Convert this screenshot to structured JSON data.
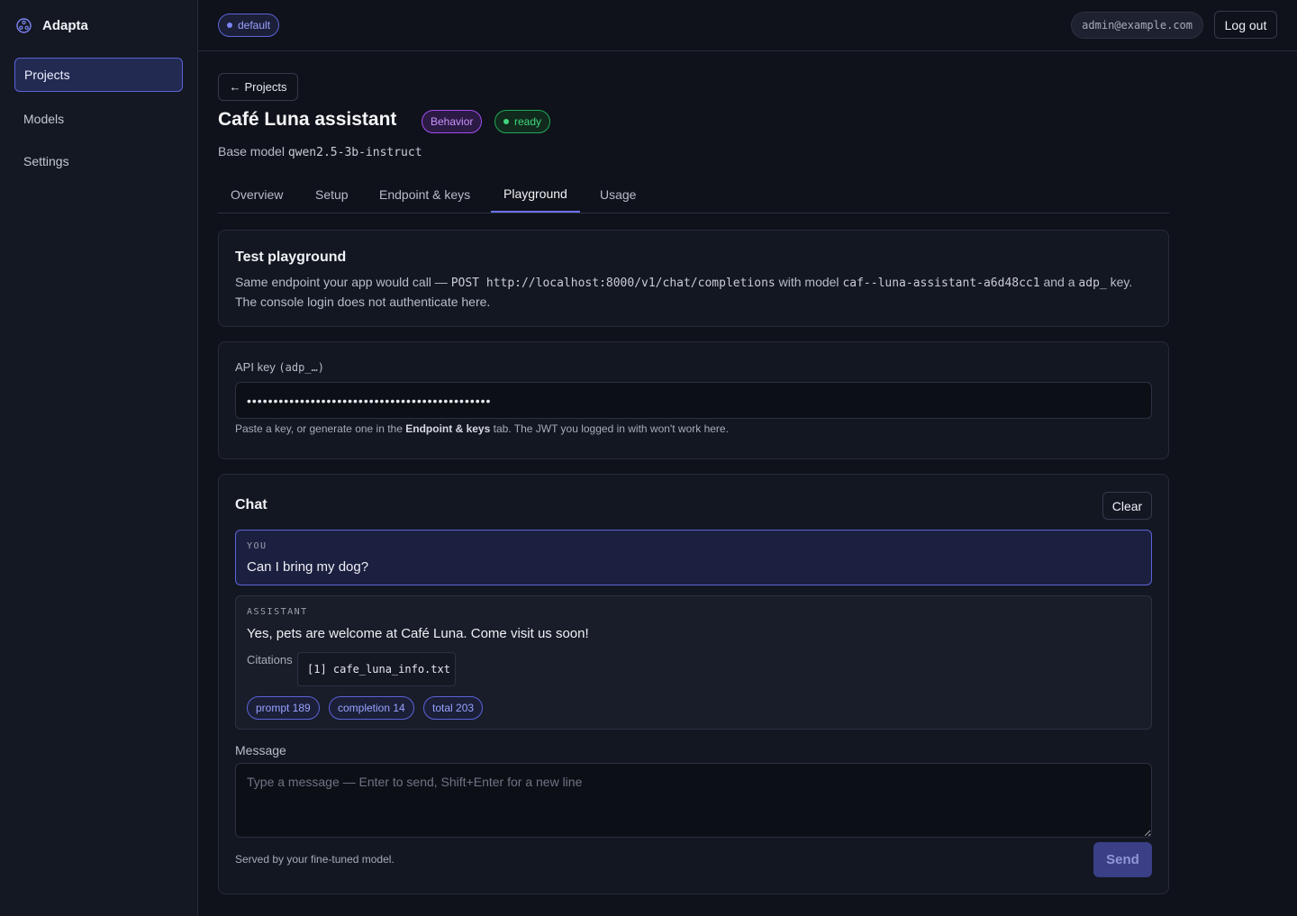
{
  "app": {
    "name": "Adapta"
  },
  "sidebar": {
    "items": [
      {
        "label": "Projects",
        "active": true
      },
      {
        "label": "Models",
        "active": false
      },
      {
        "label": "Settings",
        "active": false
      }
    ]
  },
  "topbar": {
    "namespace": "default",
    "user_email": "admin@example.com",
    "logout_label": "Log out"
  },
  "project": {
    "back_label": "Projects",
    "title": "Café Luna assistant",
    "type_badge": "Behavior",
    "status_badge": "ready",
    "base_model_label": "Base model",
    "base_model": "qwen2.5-3b-instruct"
  },
  "tabs": [
    {
      "label": "Overview"
    },
    {
      "label": "Setup"
    },
    {
      "label": "Endpoint & keys"
    },
    {
      "label": "Playground",
      "active": true
    },
    {
      "label": "Usage"
    }
  ],
  "playground": {
    "title": "Test playground",
    "desc_1": "Same endpoint your app would call —",
    "endpoint": "POST http://localhost:8000/v1/chat/completions",
    "desc_2": "with model",
    "model_id": "caf--luna-assistant-a6d48cc1",
    "desc_3": "and a",
    "key_prefix": "adp_",
    "desc_4": "key. The console login does not authenticate here."
  },
  "api_key": {
    "label": "API key",
    "label_hint": "(adp_…)",
    "value": "••••••••••••••••••••••••••••••••••••••••••••••",
    "hint_1": "Paste a key, or generate one in the",
    "hint_bold": "Endpoint & keys",
    "hint_2": "tab. The JWT you logged in with won't work here."
  },
  "chat": {
    "title": "Chat",
    "clear_label": "Clear",
    "messages": [
      {
        "role": "YOU",
        "text": "Can I bring my dog?"
      },
      {
        "role": "ASSISTANT",
        "text": "Yes, pets are welcome at Café Luna. Come visit us soon!"
      }
    ],
    "citations_label": "Citations",
    "citation": "[1] cafe_luna_info.txt",
    "usage": {
      "prompt": "prompt 189",
      "completion": "completion 14",
      "total": "total 203"
    },
    "message_label": "Message",
    "message_placeholder": "Type a message — Enter to send, Shift+Enter for a new line",
    "message_value": "",
    "footer_note": "Served by your fine-tuned model.",
    "send_label": "Send"
  },
  "colors": {
    "accent": "#5b63d6",
    "behavior": "#a24ef0",
    "ready": "#1fa857",
    "background": "#0f121a"
  },
  "icons": {
    "brand": "logo-icon",
    "back": "arrow-left-icon"
  }
}
